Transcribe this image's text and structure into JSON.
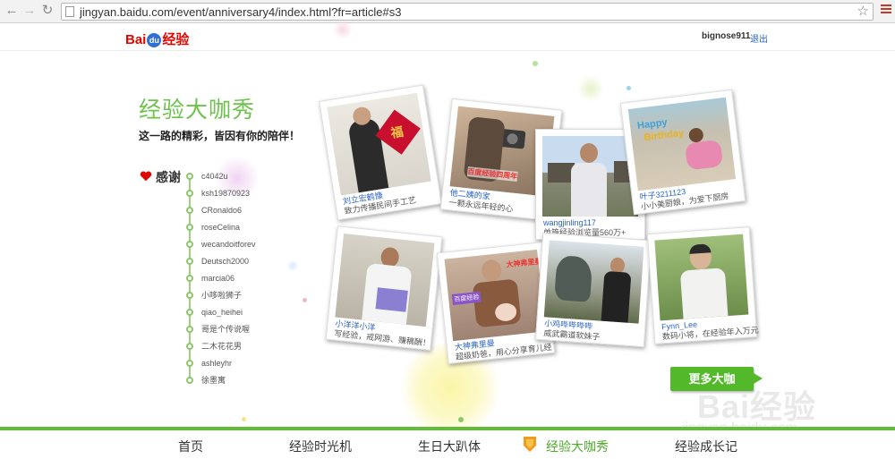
{
  "browser": {
    "url": "jingyan.baidu.com/event/anniversary4/index.html?fr=article#s3"
  },
  "header": {
    "logo_bai": "Bai",
    "logo_du": "du",
    "logo_jingyan": "经验",
    "username": "bignose911",
    "logout": "退出"
  },
  "hero": {
    "title": "经验大咖秀",
    "subtitle": "这一路的精彩，皆因有你的陪伴！"
  },
  "thanks": {
    "label": "感谢",
    "names": [
      "c4042u",
      "ksh19870923",
      "CRonaldo6",
      "roseCelina",
      "wecandoitforev",
      "Deutsch2000",
      "marcia06",
      "小哆啦狮子",
      "qiao_heihei",
      "哥是个传说喔",
      "二木花花男",
      "ashleyhr",
      "徐墨寓"
    ]
  },
  "photos": [
    {
      "name": "刘立宏鹤慷",
      "desc": "致力传播民间手工艺",
      "overlay": ""
    },
    {
      "name": "他二姨的家",
      "desc": "一颗永远年轻的心",
      "overlay": "百度经验四周年"
    },
    {
      "name": "wangjinling117",
      "desc": "单篇经验浏览量560万+",
      "overlay": ""
    },
    {
      "name": "叶子3211123",
      "desc": "小小美厨娘，为爱下厨房",
      "overlay": ""
    },
    {
      "name": "小洋洋小洋",
      "desc": "写经验，戒网游、赚稿酬！",
      "overlay": ""
    },
    {
      "name": "大神弗里曼",
      "desc": "超级奶爸，用心分享育儿经",
      "overlay": "大神弗里曼",
      "overlay2": "百度经验"
    },
    {
      "name": "小鸡哔哔哔哔",
      "desc": "威武霸道软妹子",
      "overlay": ""
    },
    {
      "name": "Fynn_Lee",
      "desc": "数码小将，在经验年入万元",
      "overlay": ""
    }
  ],
  "more_button": "更多大咖",
  "bottom_nav": [
    {
      "label": "首页",
      "active": false
    },
    {
      "label": "经验时光机",
      "active": false
    },
    {
      "label": "生日大趴体",
      "active": false
    },
    {
      "label": "经验大咖秀",
      "active": true
    },
    {
      "label": "经验成长记",
      "active": false
    }
  ],
  "watermark": {
    "brand": "Bai经验",
    "url": "jingyan.baidu.com"
  },
  "colors": {
    "accent_green": "#6cc34a",
    "nav_bar_green": "#5fbe34",
    "link_blue": "#2a64c5",
    "baidu_red": "#e10601"
  }
}
